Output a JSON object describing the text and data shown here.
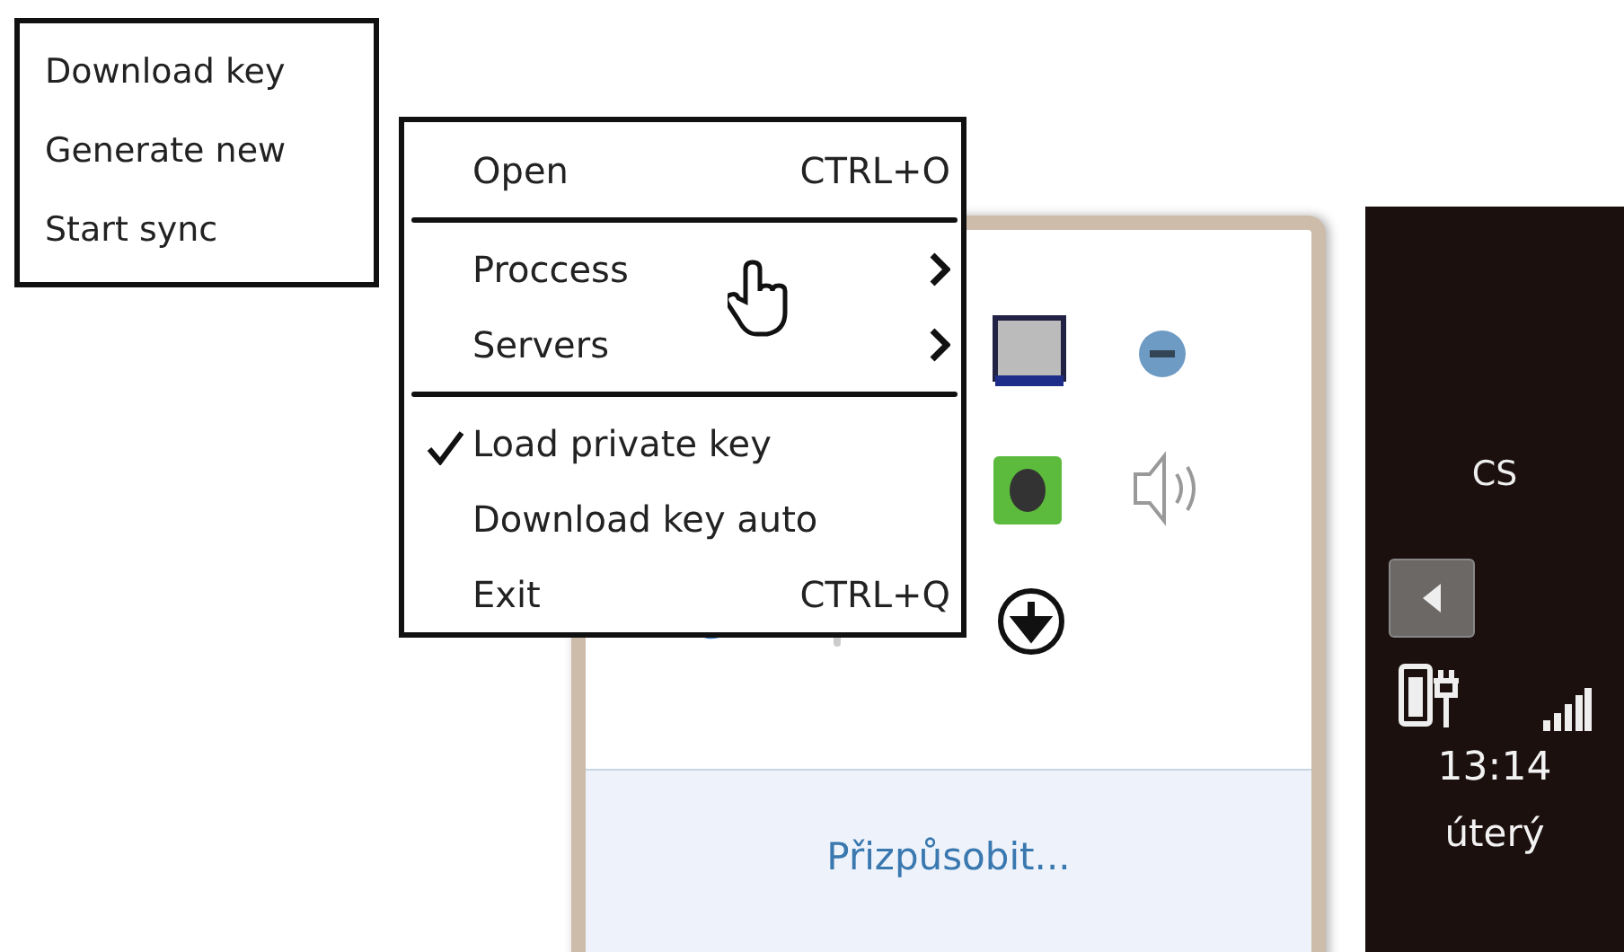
{
  "submenu": {
    "items": [
      {
        "label": "Download key"
      },
      {
        "label": "Generate new"
      },
      {
        "label": "Start sync"
      }
    ]
  },
  "context_menu": {
    "items": [
      {
        "kind": "item",
        "label": "Open",
        "shortcut": "CTRL+O",
        "checked": false,
        "submenu": false
      },
      {
        "kind": "separator"
      },
      {
        "kind": "item",
        "label": "Proccess",
        "checked": false,
        "submenu": true
      },
      {
        "kind": "item",
        "label": "Servers",
        "checked": false,
        "submenu": true
      },
      {
        "kind": "separator"
      },
      {
        "kind": "item",
        "label": "Load private key",
        "checked": true,
        "submenu": false
      },
      {
        "kind": "item",
        "label": "Download key auto",
        "checked": false,
        "submenu": false
      },
      {
        "kind": "item",
        "label": "Exit",
        "shortcut": "CTRL+Q",
        "checked": false,
        "submenu": false
      }
    ]
  },
  "tray_popup": {
    "customize_link": "Přizpůsobit..."
  },
  "taskbar": {
    "language": "CS",
    "time": "13:14",
    "day": "úterý"
  }
}
